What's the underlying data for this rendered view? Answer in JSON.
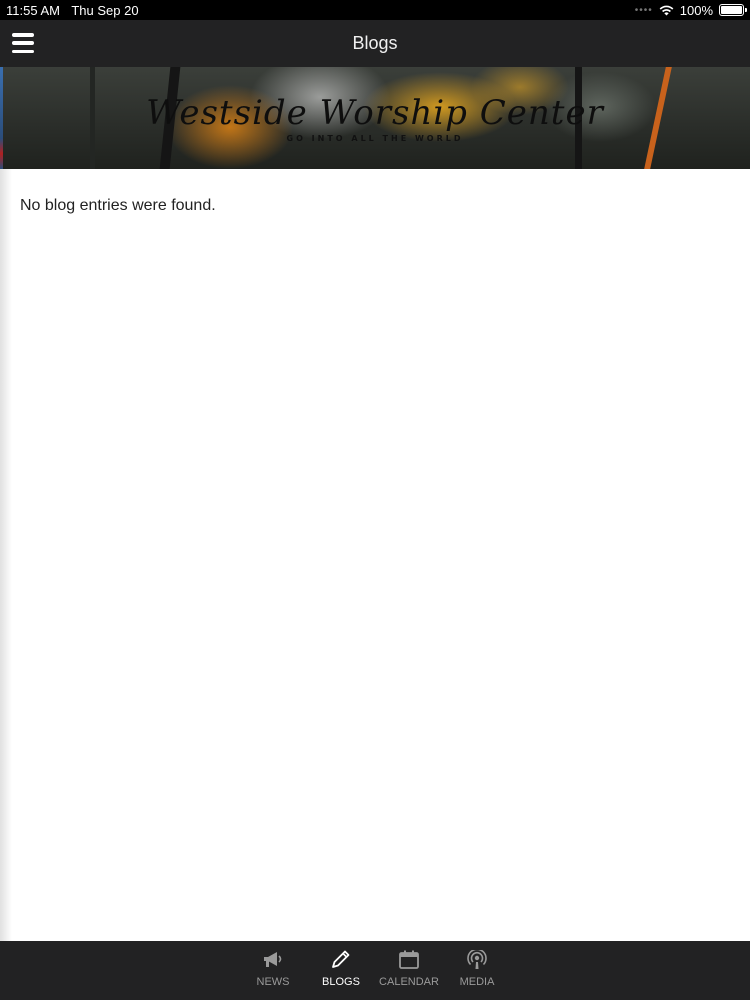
{
  "status_bar": {
    "time": "11:55 AM",
    "date": "Thu Sep 20",
    "battery": "100%",
    "battery_level": 1.0
  },
  "nav": {
    "title": "Blogs",
    "menu_icon": "hamburger-menu-icon"
  },
  "banner": {
    "title": "Westside Worship Center",
    "tagline": "GO INTO ALL THE WORLD"
  },
  "content": {
    "empty_message": "No blog entries were found."
  },
  "tabs": [
    {
      "label": "NEWS",
      "icon": "megaphone-icon",
      "active": false
    },
    {
      "label": "BLOGS",
      "icon": "pencil-icon",
      "active": true
    },
    {
      "label": "CALENDAR",
      "icon": "calendar-icon",
      "active": false
    },
    {
      "label": "MEDIA",
      "icon": "podcast-icon",
      "active": false
    }
  ],
  "colors": {
    "bar_background": "#222223",
    "tab_active": "#ffffff",
    "tab_inactive": "#9a9a9a"
  }
}
